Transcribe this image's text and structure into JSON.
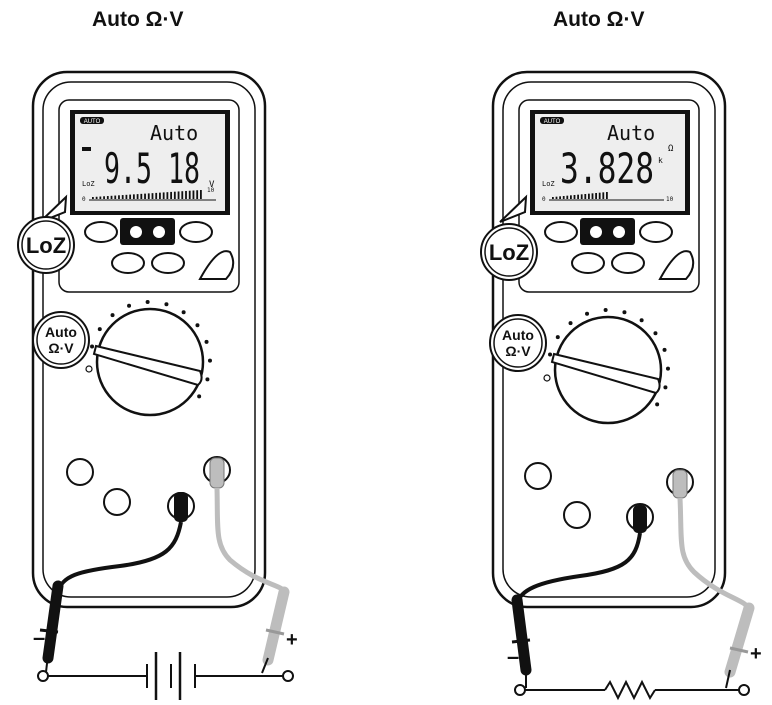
{
  "panels": [
    {
      "title": "Auto Ω·V",
      "lcd": {
        "badge": "AUTO",
        "mode": "Auto",
        "reading": "9.5 18",
        "prefix": "",
        "unit": "V",
        "loz": "LoZ",
        "scale_min": "0",
        "scale_max": "10"
      },
      "callout": "LoZ",
      "dial_label": [
        "Auto",
        "Ω·V"
      ],
      "load": "battery",
      "polarity": {
        "neg": "–",
        "pos": "+"
      }
    },
    {
      "title": "Auto Ω·V",
      "lcd": {
        "badge": "AUTO",
        "mode": "Auto",
        "reading": "3.828",
        "prefix": "k",
        "unit": "Ω",
        "loz": "LoZ",
        "scale_min": "0",
        "scale_max": "10"
      },
      "callout": "LoZ",
      "dial_label": [
        "Auto",
        "Ω·V"
      ],
      "load": "resistor",
      "polarity": {
        "neg": "–",
        "pos": "+"
      }
    }
  ]
}
